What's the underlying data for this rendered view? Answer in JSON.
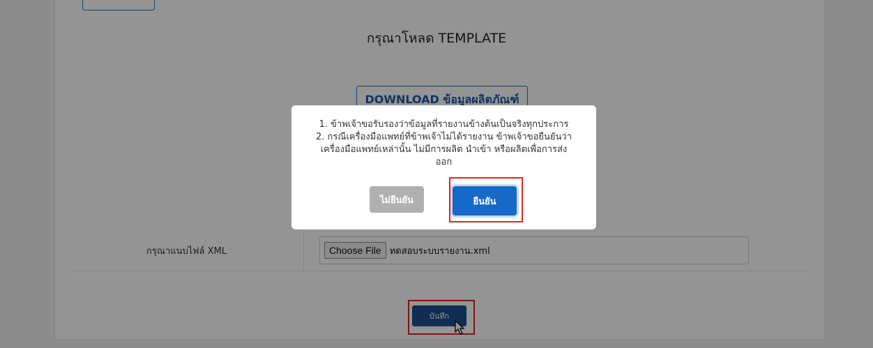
{
  "page": {
    "title": "กรุณาโหลด TEMPLATE",
    "download_label": "DOWNLOAD ข้อมูลผลิตภัณฑ์"
  },
  "form": {
    "attach_label": "กรุณาแนบไฟล์ XML",
    "choose_file_label": "Choose File",
    "file_name": "ทดสอบระบบรายงาน.xml",
    "save_label": "บันทึก"
  },
  "modal": {
    "lines": [
      "1. ข้าพเจ้าขอรับรองว่าข้อมูลที่รายงานข้างต้นเป็นจริงทุกประการ",
      "2. กรณีเครื่องมือแพทย์ที่ข้าพเจ้าไม่ได้รายงาน ข้าพเจ้าขอยืนยันว่า",
      "เครื่องมือแพทย์เหล่านั้น ไม่มีการผลิต นำเข้า หรือผลิตเพื่อการส่ง",
      "ออก"
    ],
    "cancel_label": "ไม่ยืนยัน",
    "confirm_label": "ยืนยัน"
  },
  "colors": {
    "primary": "#1769c7",
    "highlight": "#e0231d"
  }
}
